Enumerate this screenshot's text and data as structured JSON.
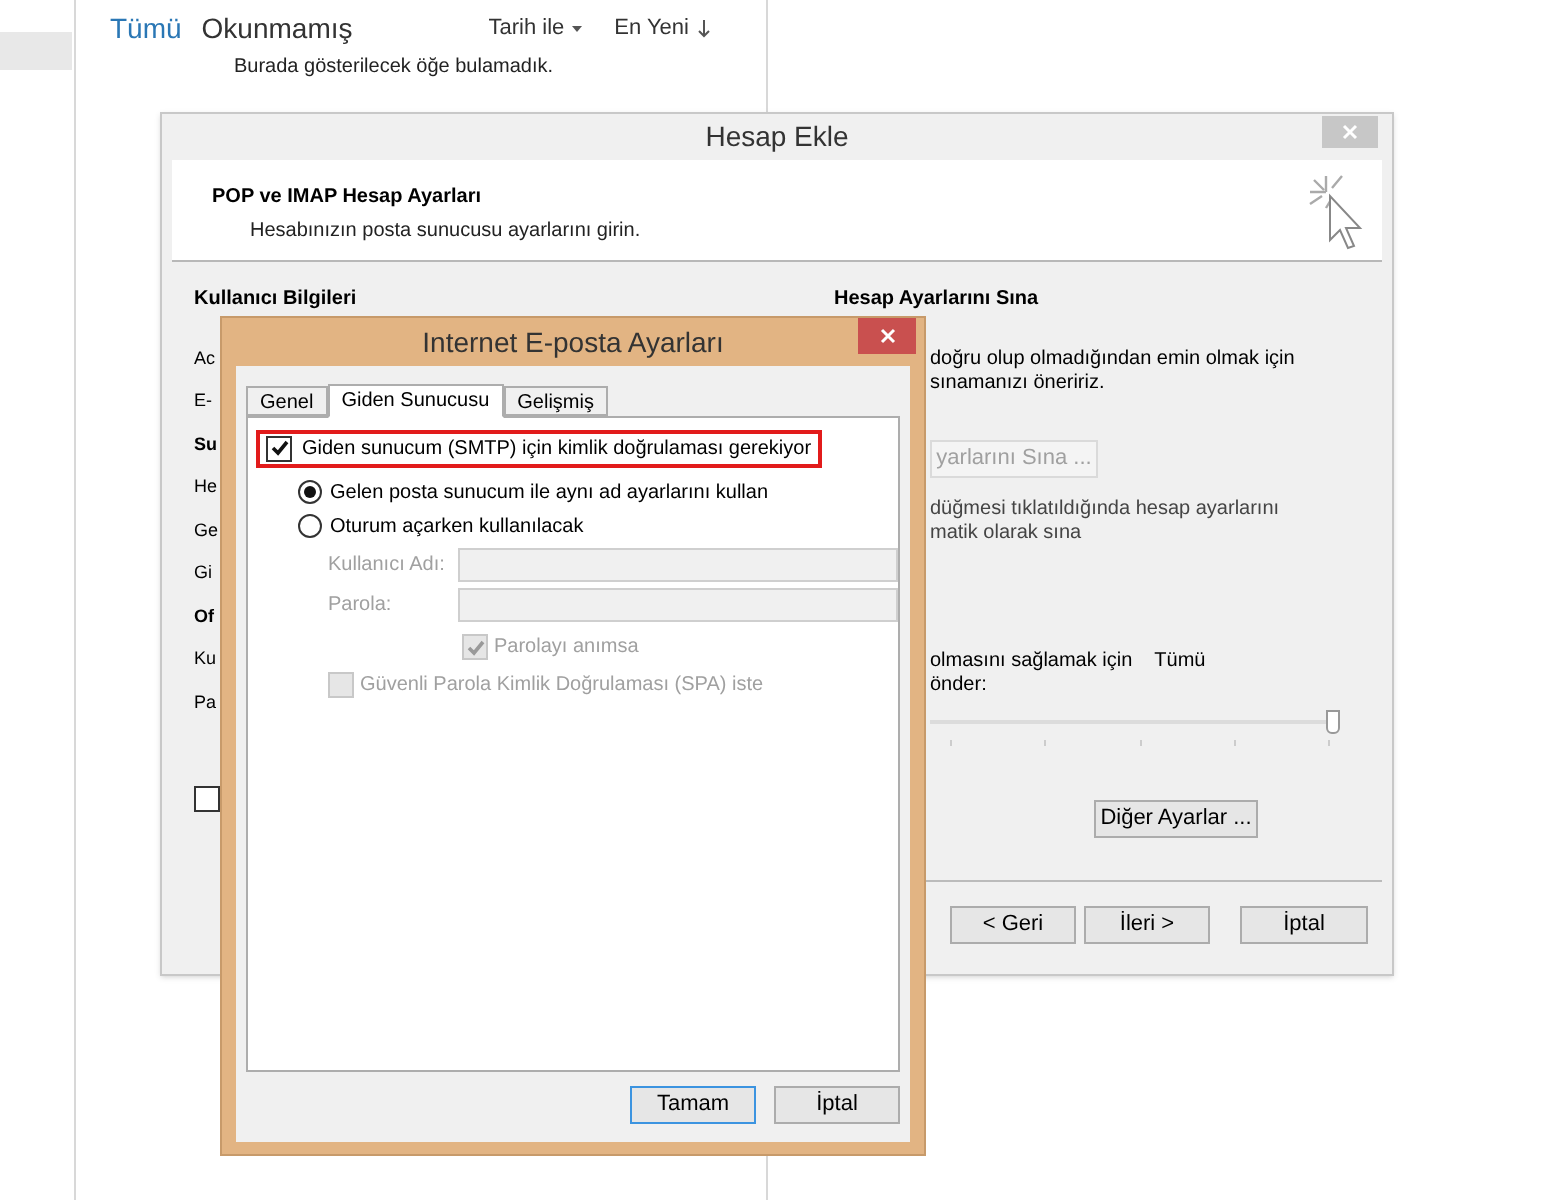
{
  "mail_list": {
    "filters": [
      {
        "label": "Tümü",
        "selected": true
      },
      {
        "label": "Okunmamış",
        "selected": false
      }
    ],
    "sort_by": "Tarih ile",
    "order": "En Yeni",
    "empty_message": "Burada gösterilecek öğe bulamadık."
  },
  "add_account_dialog": {
    "title": "Hesap Ekle",
    "heading": "POP ve IMAP Hesap Ayarları",
    "subheading": "Hesabınızın posta sunucusu ayarlarını girin.",
    "left_labels": [
      {
        "text": "Kullanıcı Bilgileri",
        "kind": "header"
      },
      {
        "text": "Ac",
        "kind": "label"
      },
      {
        "text": "E-",
        "kind": "label"
      },
      {
        "text": "Su",
        "kind": "header"
      },
      {
        "text": "He",
        "kind": "label"
      },
      {
        "text": "Ge",
        "kind": "label"
      },
      {
        "text": "Gi",
        "kind": "label"
      },
      {
        "text": "Of",
        "kind": "header"
      },
      {
        "text": "Ku",
        "kind": "label"
      },
      {
        "text": "Pa",
        "kind": "label"
      }
    ],
    "left_checkbox": {
      "checked": false
    },
    "test_heading": "Hesap Ayarlarını Sına",
    "test_text": [
      "doğru olup olmadığından emin olmak için",
      "sınamanızı öneririz."
    ],
    "test_button": {
      "label": "yarlarını Sına ...",
      "disabled": true
    },
    "auto_test_text": [
      "düğmesi tıklatıldığında hesap ayarlarını",
      "matik olarak sına"
    ],
    "deliver_text": [
      "olmasını sağlamak için",
      "önder:"
    ],
    "deliver_value": "Tümü",
    "deliver_slider": {
      "level": 1
    },
    "more_settings_button": "Diğer Ayarlar ...",
    "buttons": [
      "< Geri",
      "İleri >",
      "İptal"
    ]
  },
  "internet_settings_dialog": {
    "title": "Internet E-posta Ayarları",
    "tabs": [
      {
        "label": "Genel",
        "selected": false
      },
      {
        "label": "Giden Sunucusu",
        "selected": true
      },
      {
        "label": "Gelişmiş",
        "selected": false
      }
    ],
    "smtp_auth": {
      "label": "Giden sunucum (SMTP) için kimlik doğrulaması gerekiyor",
      "checked": true
    },
    "radios": [
      {
        "label": "Gelen posta sunucum ile aynı ad ayarlarını kullan",
        "selected": true
      },
      {
        "label": "Oturum açarken kullanılacak",
        "selected": false
      }
    ],
    "fields": [
      {
        "label": "Kullanıcı Adı:",
        "disabled": true
      },
      {
        "label": "Parola:",
        "disabled": true
      }
    ],
    "remember_password": {
      "label": "Parolayı anımsa",
      "checked": true,
      "disabled": true
    },
    "spa": {
      "label": "Güvenli Parola Kimlik Doğrulaması (SPA) iste",
      "checked": false,
      "disabled": true
    },
    "buttons": [
      "Tamam",
      "İptal"
    ]
  }
}
